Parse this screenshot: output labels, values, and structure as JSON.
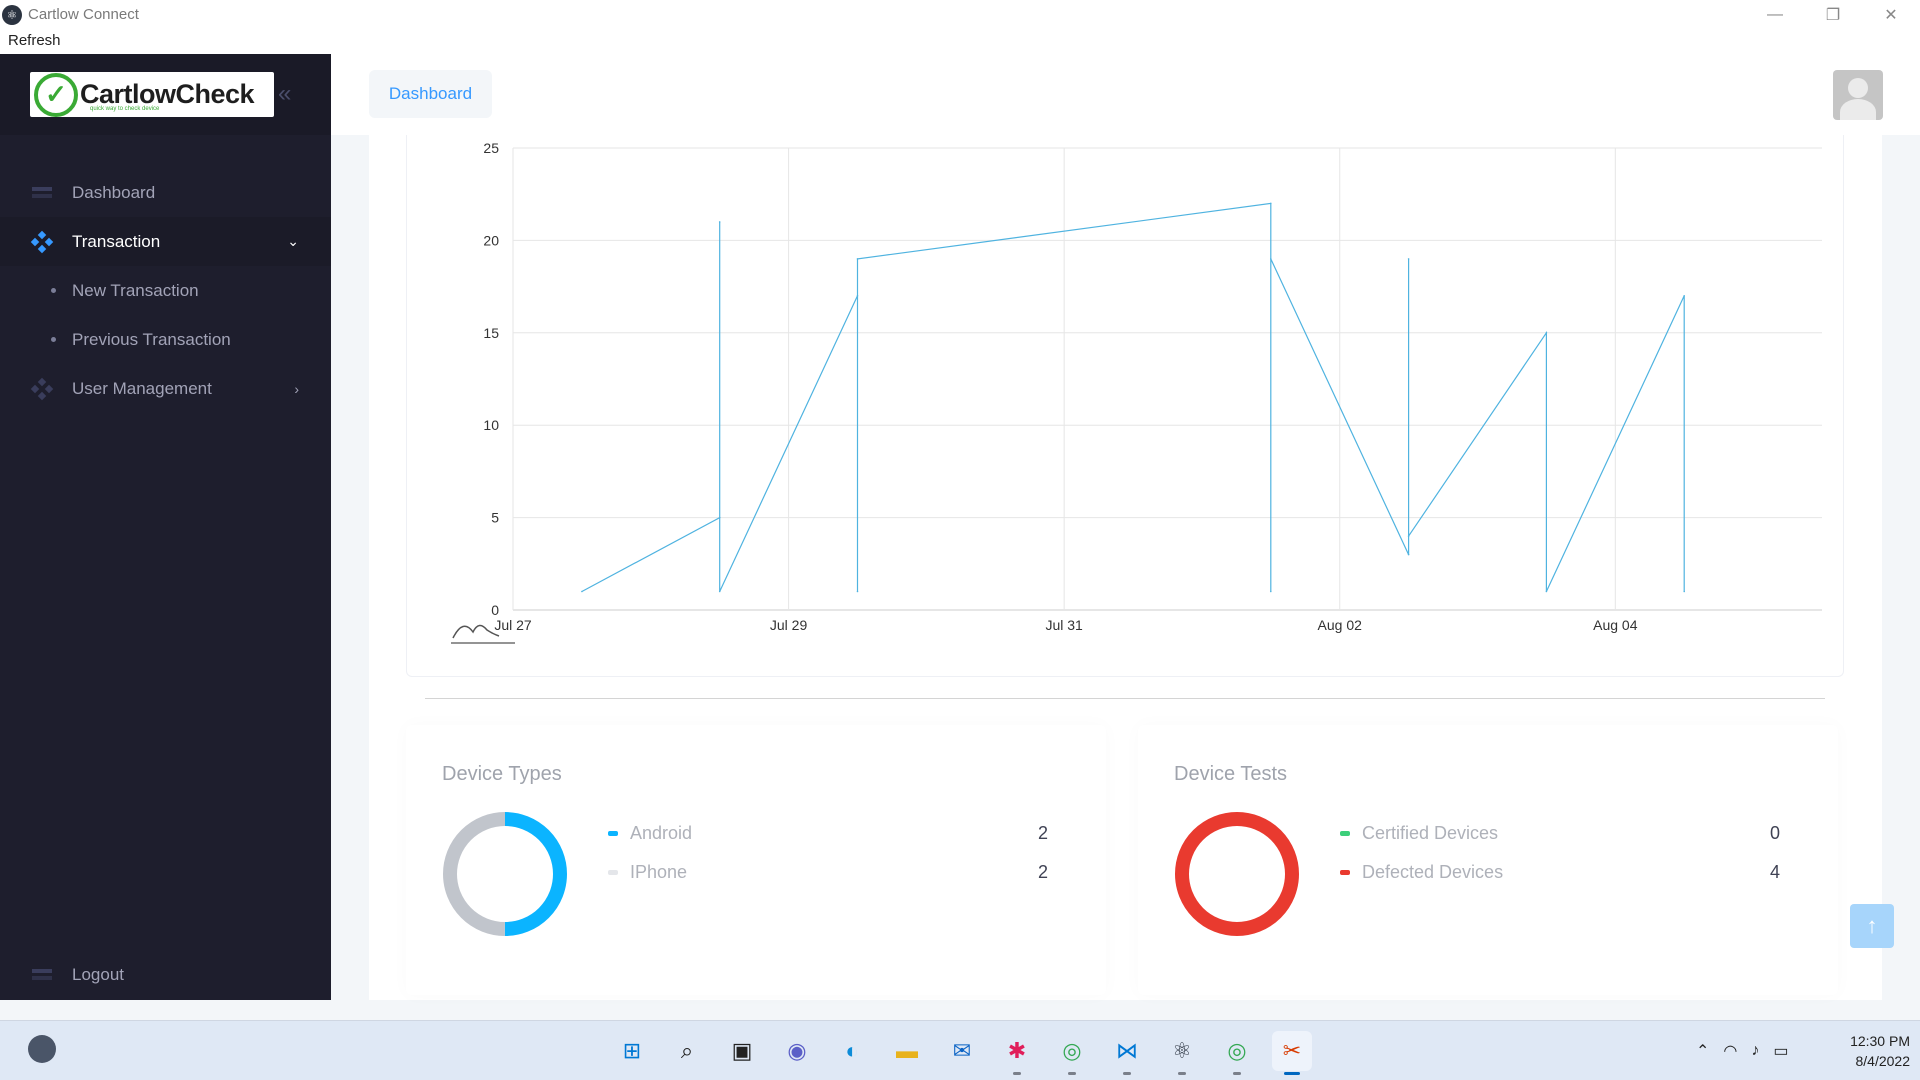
{
  "window": {
    "title": "Cartlow Connect",
    "app_icon": "electron-atom-icon",
    "controls": [
      "minimize",
      "restore",
      "close"
    ]
  },
  "menubar": {
    "refresh_label": "Refresh"
  },
  "brand": {
    "logo_text": "CartlowCheck",
    "logo_tagline": "quick way to check device",
    "collapse_icon": "double-chevron-left-icon"
  },
  "sidebar": {
    "items": [
      {
        "label": "Dashboard",
        "icon": "dashboard-icon"
      },
      {
        "label": "Transaction",
        "icon": "transaction-icon",
        "expanded": true
      },
      {
        "label": "New Transaction"
      },
      {
        "label": "Previous Transaction"
      },
      {
        "label": "User Management",
        "icon": "users-icon"
      }
    ],
    "logout_label": "Logout"
  },
  "header": {
    "tab_label": "Dashboard",
    "avatar_icon": "user-avatar-icon"
  },
  "chart_data": {
    "type": "line",
    "x_type": "datetime",
    "xlim": [
      "2022-07-27",
      "2022-08-05 12:00"
    ],
    "ylim": [
      0,
      25
    ],
    "y_ticks": [
      0,
      5,
      10,
      15,
      20,
      25
    ],
    "x_ticks": [
      "Jul 27",
      "Jul 29",
      "Jul 31",
      "Aug 02",
      "Aug 04"
    ],
    "x_tick_dates": [
      "2022-07-27",
      "2022-07-29",
      "2022-07-31",
      "2022-08-02",
      "2022-08-04"
    ],
    "grid": true,
    "color": "#4fb3e0",
    "series": [
      {
        "points": [
          [
            "2022-07-27 12:00",
            1
          ],
          [
            "2022-07-28 12:00",
            5
          ],
          [
            "2022-07-28 12:00",
            21
          ],
          [
            "2022-07-28 12:00",
            1
          ],
          [
            "2022-07-29 12:00",
            17
          ],
          [
            "2022-07-29 12:00",
            1
          ],
          [
            "2022-07-29 12:00",
            19
          ],
          [
            "2022-08-01 12:00",
            22
          ],
          [
            "2022-08-01 12:00",
            1
          ],
          [
            "2022-08-01 12:00",
            19
          ],
          [
            "2022-08-02 12:00",
            3
          ],
          [
            "2022-08-02 12:00",
            19
          ],
          [
            "2022-08-02 12:00",
            4
          ],
          [
            "2022-08-03 12:00",
            15
          ],
          [
            "2022-08-03 12:00",
            1
          ],
          [
            "2022-08-04 12:00",
            17
          ],
          [
            "2022-08-04 12:00",
            1
          ]
        ]
      }
    ],
    "navigator_icon": "range-navigator-icon"
  },
  "device_types": {
    "title": "Device Types",
    "chart_type": "donut",
    "items": [
      {
        "label": "Android",
        "value": "2",
        "color": "#0bb4ff"
      },
      {
        "label": "IPhone",
        "value": "2",
        "color": "#c1c5cc"
      }
    ]
  },
  "device_tests": {
    "title": "Device Tests",
    "chart_type": "donut",
    "items": [
      {
        "label": "Certified Devices",
        "value": "0",
        "color": "#3ccf7a"
      },
      {
        "label": "Defected Devices",
        "value": "4",
        "color": "#e93a2f"
      }
    ]
  },
  "scroll_top_icon": "arrow-up-icon",
  "taskbar": {
    "apps": [
      "start-icon",
      "search-icon",
      "task-view-icon",
      "chat-icon",
      "edge-icon",
      "file-explorer-icon",
      "mail-icon",
      "slack-icon",
      "chrome-icon",
      "vscode-icon",
      "electron-icon",
      "chrome-profile-icon",
      "snipping-tool-icon"
    ],
    "time": "12:30 PM",
    "date": "8/4/2022"
  }
}
